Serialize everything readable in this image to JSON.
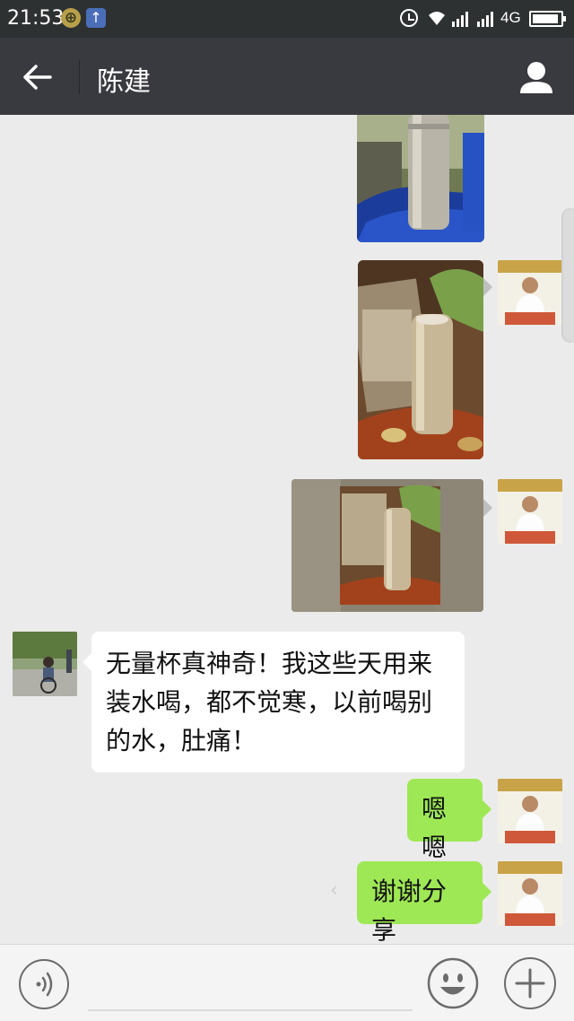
{
  "status_bar": {
    "time": "21:53",
    "network_type": "4G",
    "icons": [
      "coin-icon",
      "upload-icon",
      "alarm-icon",
      "wifi-icon",
      "signal-icon",
      "signal-icon",
      "battery-icon"
    ]
  },
  "header": {
    "title": "陈建",
    "back_icon": "back-arrow-icon",
    "profile_icon": "person-icon"
  },
  "messages": [
    {
      "type": "image",
      "direction": "out",
      "subject": "steel thermos bottle on blue cloth"
    },
    {
      "type": "image",
      "direction": "out",
      "subject": "gold thermos cup on wooden table"
    },
    {
      "type": "image",
      "direction": "out",
      "subject": "gold thermos cup forwarded photo"
    },
    {
      "type": "text",
      "direction": "in",
      "text": "无量杯真神奇！我这些天用来装水喝，都不觉寒，以前喝别的水，肚痛！"
    },
    {
      "type": "text",
      "direction": "out",
      "text": "嗯嗯"
    },
    {
      "type": "text",
      "direction": "out",
      "text": "谢谢分享"
    }
  ],
  "input_bar": {
    "icons": [
      "voice-icon",
      "emoji-icon",
      "plus-icon"
    ]
  },
  "colors": {
    "status_bar": "#2e3132",
    "title_bar": "#393a3f",
    "chat_bg": "#ebebeb",
    "bubble_out": "#9ee855",
    "bubble_in": "#ffffff"
  }
}
